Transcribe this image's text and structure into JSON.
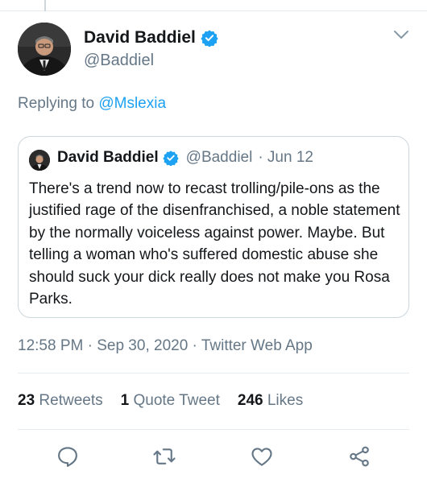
{
  "tweet": {
    "author": {
      "name": "David Baddiel",
      "handle": "@Baddiel",
      "verified": true
    },
    "replying_prefix": "Replying to",
    "replying_to": "@Mslexia",
    "quoted": {
      "name": "David Baddiel",
      "handle": "@Baddiel",
      "date": "· Jun 12",
      "text": "There's a trend now to recast trolling/pile-ons as the justified rage of the disenfranchised, a noble statement by the normally voiceless against power. Maybe. But telling a woman who's suffered domestic abuse she should suck your dick really does not make you Rosa Parks."
    },
    "meta": {
      "time": "12:58 PM",
      "date": "Sep 30, 2020",
      "source": "Twitter Web App",
      "sep": "·"
    },
    "stats": {
      "retweets_count": "23",
      "retweets_label": "Retweets",
      "quotes_count": "1",
      "quotes_label": "Quote Tweet",
      "likes_count": "246",
      "likes_label": "Likes"
    },
    "actions": [
      "reply-icon",
      "retweet-icon",
      "like-icon",
      "share-icon"
    ]
  },
  "colors": {
    "accent": "#1da1f2",
    "muted": "#657786",
    "text": "#14171a",
    "border": "#ccd6dd",
    "divider": "#e6ecf0"
  }
}
